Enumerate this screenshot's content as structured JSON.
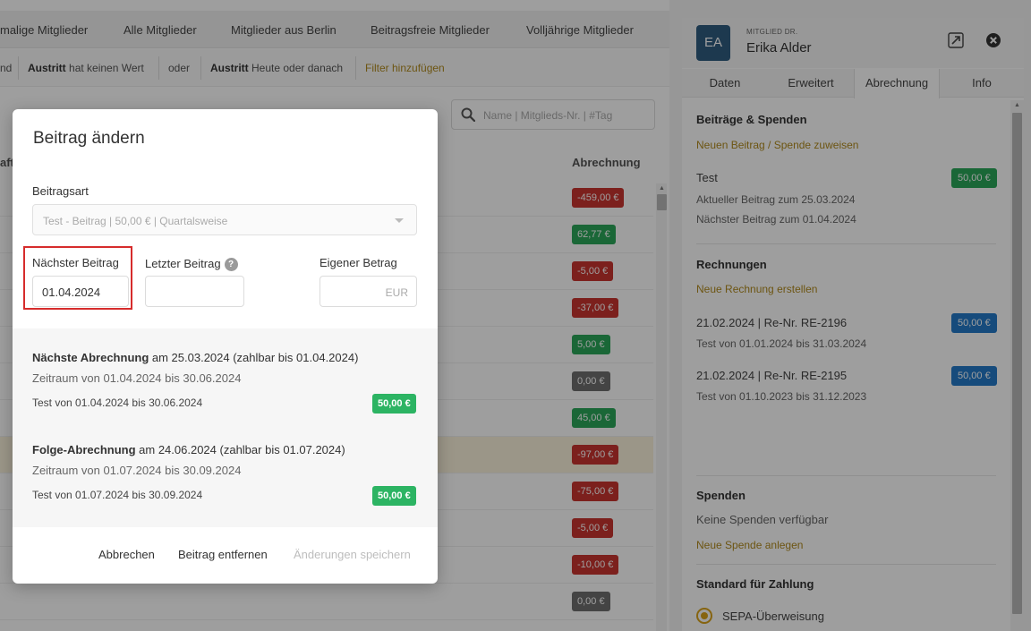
{
  "list": {
    "tabs": [
      "malige Mitglieder",
      "Alle Mitglieder",
      "Mitglieder aus Berlin",
      "Beitragsfreie Mitglieder",
      "Volljährige Mitglieder"
    ],
    "filters": {
      "lead": "nd",
      "f1_field": "Austritt",
      "f1_cond": "hat keinen Wert",
      "or": "oder",
      "f2_field": "Austritt",
      "f2_cond": "Heute oder danach",
      "add": "Filter hinzufügen"
    },
    "search_placeholder": "Name | Mitglieds-Nr. | #Tag",
    "left_head": "aft",
    "column_header": "Abrechnung",
    "amounts": [
      {
        "value": "-459,00 €",
        "status": "red"
      },
      {
        "value": "62,77 €",
        "status": "green"
      },
      {
        "value": "-5,00 €",
        "status": "red"
      },
      {
        "value": "-37,00 €",
        "status": "red"
      },
      {
        "value": "5,00 €",
        "status": "green"
      },
      {
        "value": "0,00 €",
        "status": "gray"
      },
      {
        "value": "45,00 €",
        "status": "green"
      },
      {
        "value": "-97,00 €",
        "status": "red"
      },
      {
        "value": "-75,00 €",
        "status": "red"
      },
      {
        "value": "-5,00 €",
        "status": "red"
      },
      {
        "value": "-10,00 €",
        "status": "red"
      },
      {
        "value": "0,00 €",
        "status": "gray"
      }
    ]
  },
  "panel": {
    "initials": "EA",
    "member_type": "MITGLIED DR.",
    "name": "Erika Alder",
    "tabs": [
      "Daten",
      "Erweitert",
      "Abrechnung",
      "Info"
    ],
    "beitraege": {
      "title": "Beiträge & Spenden",
      "link": "Neuen Beitrag / Spende zuweisen",
      "item_name": "Test",
      "item_amount": "50,00 €",
      "current": "Aktueller Beitrag zum 25.03.2024",
      "next": "Nächster Beitrag zum 01.04.2024"
    },
    "rechnungen": {
      "title": "Rechnungen",
      "link": "Neue Rechnung erstellen",
      "items": [
        {
          "head": "21.02.2024 | Re-Nr. RE-2196",
          "period": "Test von 01.01.2024 bis 31.03.2024",
          "amount": "50,00 €"
        },
        {
          "head": "21.02.2024 | Re-Nr. RE-2195",
          "period": "Test von 01.10.2023 bis 31.12.2023",
          "amount": "50,00 €"
        }
      ]
    },
    "spenden": {
      "title": "Spenden",
      "empty": "Keine Spenden verfügbar",
      "link": "Neue Spende anlegen"
    },
    "zahlung": {
      "title": "Standard für Zahlung",
      "option": "SEPA-Überweisung"
    }
  },
  "modal": {
    "title": "Beitrag ändern",
    "type_label": "Beitragsart",
    "type_value": "Test - Beitrag | 50,00 € | Quartalsweise",
    "next_label": "Nächster Beitrag",
    "next_value": "01.04.2024",
    "last_label": "Letzter Beitrag",
    "help": "?",
    "own_label": "Eigener Betrag",
    "own_suffix": "EUR",
    "next_billing": {
      "strong": "Nächste Abrechnung",
      "rest": " am 25.03.2024 (zahlbar bis 01.04.2024)",
      "period": "Zeitraum von 01.04.2024 bis 30.06.2024",
      "line": "Test von 01.04.2024 bis 30.06.2024",
      "amount": "50,00 €"
    },
    "follow_billing": {
      "strong": "Folge-Abrechnung",
      "rest": " am 24.06.2024 (zahlbar bis 01.07.2024)",
      "period": "Zeitraum von 01.07.2024 bis 30.09.2024",
      "line": "Test von 01.07.2024 bis 30.09.2024",
      "amount": "50,00 €"
    },
    "cancel": "Abbrechen",
    "remove": "Beitrag entfernen",
    "save": "Änderungen speichern"
  },
  "colors": {
    "accent": "#b08a1e",
    "negative": "#c8352f",
    "positive": "#2aa65a",
    "neutral": "#6e6e6e",
    "invoice": "#2479c8",
    "highlight": "#d62c2c"
  }
}
